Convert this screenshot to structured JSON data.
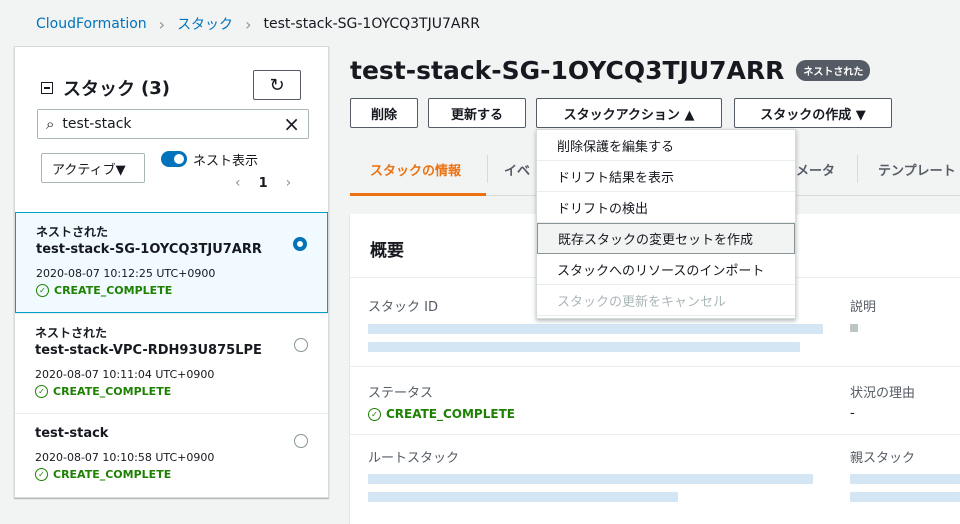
{
  "breadcrumb": {
    "root": "CloudFormation",
    "middle": "スタック",
    "current": "test-stack-SG-1OYCQ3TJU7ARR"
  },
  "sidebar": {
    "title": "スタック",
    "count": "(3)",
    "search_value": "test-stack",
    "filter_value": "アクティブ▼",
    "toggle_label": "ネスト表示",
    "page": "1",
    "stacks": [
      {
        "nested_label": "ネストされた",
        "name": "test-stack-SG-1OYCQ3TJU7ARR",
        "time": "2020-08-07 10:12:25 UTC+0900",
        "status": "CREATE_COMPLETE",
        "selected": true
      },
      {
        "nested_label": "ネストされた",
        "name": "test-stack-VPC-RDH93U875LPE",
        "time": "2020-08-07 10:11:04 UTC+0900",
        "status": "CREATE_COMPLETE",
        "selected": false
      },
      {
        "nested_label": "",
        "name": "test-stack",
        "time": "2020-08-07 10:10:58 UTC+0900",
        "status": "CREATE_COMPLETE",
        "selected": false
      }
    ]
  },
  "main": {
    "title": "test-stack-SG-1OYCQ3TJU7ARR",
    "badge": "ネストされた",
    "buttons": {
      "delete": "削除",
      "update": "更新する",
      "stack_actions": "スタックアクション ▲",
      "create_stack": "スタックの作成 ▼"
    },
    "tabs": [
      "スタックの情報",
      "イベ",
      "メータ",
      "テンプレート"
    ],
    "overview": {
      "heading": "概要",
      "stack_id_label": "スタック ID",
      "description_label": "説明",
      "status_label": "ステータス",
      "status_value": "CREATE_COMPLETE",
      "reason_label": "状況の理由",
      "reason_value": "-",
      "root_stack_label": "ルートスタック",
      "parent_stack_label": "親スタック"
    },
    "dropdown": [
      {
        "label": "削除保護を編集する",
        "state": "normal"
      },
      {
        "label": "ドリフト結果を表示",
        "state": "normal"
      },
      {
        "label": "ドリフトの検出",
        "state": "normal"
      },
      {
        "label": "既存スタックの変更セットを作成",
        "state": "hover"
      },
      {
        "label": "スタックへのリソースのインポート",
        "state": "normal"
      },
      {
        "label": "スタックの更新をキャンセル",
        "state": "disabled"
      }
    ]
  }
}
